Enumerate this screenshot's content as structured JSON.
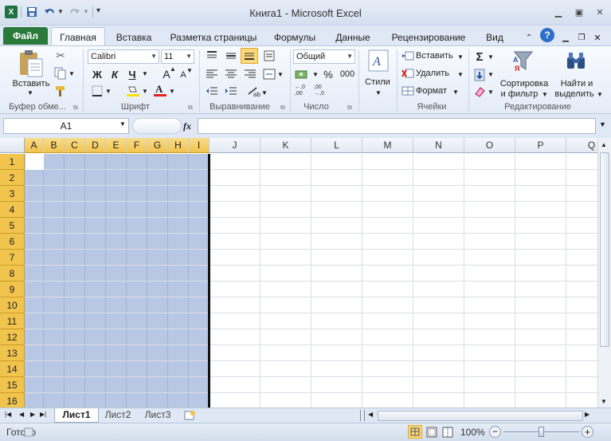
{
  "window": {
    "title": "Книга1  -  Microsoft Excel",
    "qat": {
      "save_icon": "save-icon",
      "undo_icon": "undo-icon",
      "redo_icon": "redo-icon"
    }
  },
  "tabs": [
    "Файл",
    "Главная",
    "Вставка",
    "Разметка страницы",
    "Формулы",
    "Данные",
    "Рецензирование",
    "Вид"
  ],
  "ribbon": {
    "clipboard": {
      "paste": "Вставить",
      "label": "Буфер обме..."
    },
    "font": {
      "name": "Calibri",
      "size": "11",
      "bold": "Ж",
      "italic": "К",
      "underline": "Ч",
      "grow": "A",
      "shrink": "A",
      "label": "Шрифт"
    },
    "alignment": {
      "label": "Выравнивание"
    },
    "number": {
      "format": "Общий",
      "percent": "%",
      "thousands": "000",
      "label": "Число"
    },
    "styles": {
      "button": "Стили"
    },
    "cells": {
      "insert": "Вставить",
      "delete": "Удалить",
      "format": "Формат",
      "label": "Ячейки"
    },
    "editing": {
      "sum": "Σ",
      "sort_line1": "Сортировка",
      "sort_line2": "и фильтр",
      "find_line1": "Найти и",
      "find_line2": "выделить",
      "label": "Редактирование"
    }
  },
  "formula_bar": {
    "name_box": "A1",
    "fx": "fx",
    "value": ""
  },
  "grid": {
    "columns": [
      "A",
      "B",
      "C",
      "D",
      "E",
      "F",
      "G",
      "H",
      "I",
      "J",
      "K",
      "L",
      "M",
      "N",
      "O",
      "P",
      "Q"
    ],
    "selected_columns": [
      "A",
      "B",
      "C",
      "D",
      "E",
      "F",
      "G",
      "H",
      "I"
    ],
    "rows": [
      "1",
      "2",
      "3",
      "4",
      "5",
      "6",
      "7",
      "8",
      "9",
      "10",
      "11",
      "12",
      "13",
      "14",
      "15",
      "16"
    ]
  },
  "sheets": [
    "Лист1",
    "Лист2",
    "Лист3"
  ],
  "status": {
    "ready": "Готово",
    "zoom": "100%"
  },
  "colors": {
    "file_tab": "#2a7a3b",
    "selection": "#b8c8e4",
    "header_selected": "#f1c44e"
  }
}
